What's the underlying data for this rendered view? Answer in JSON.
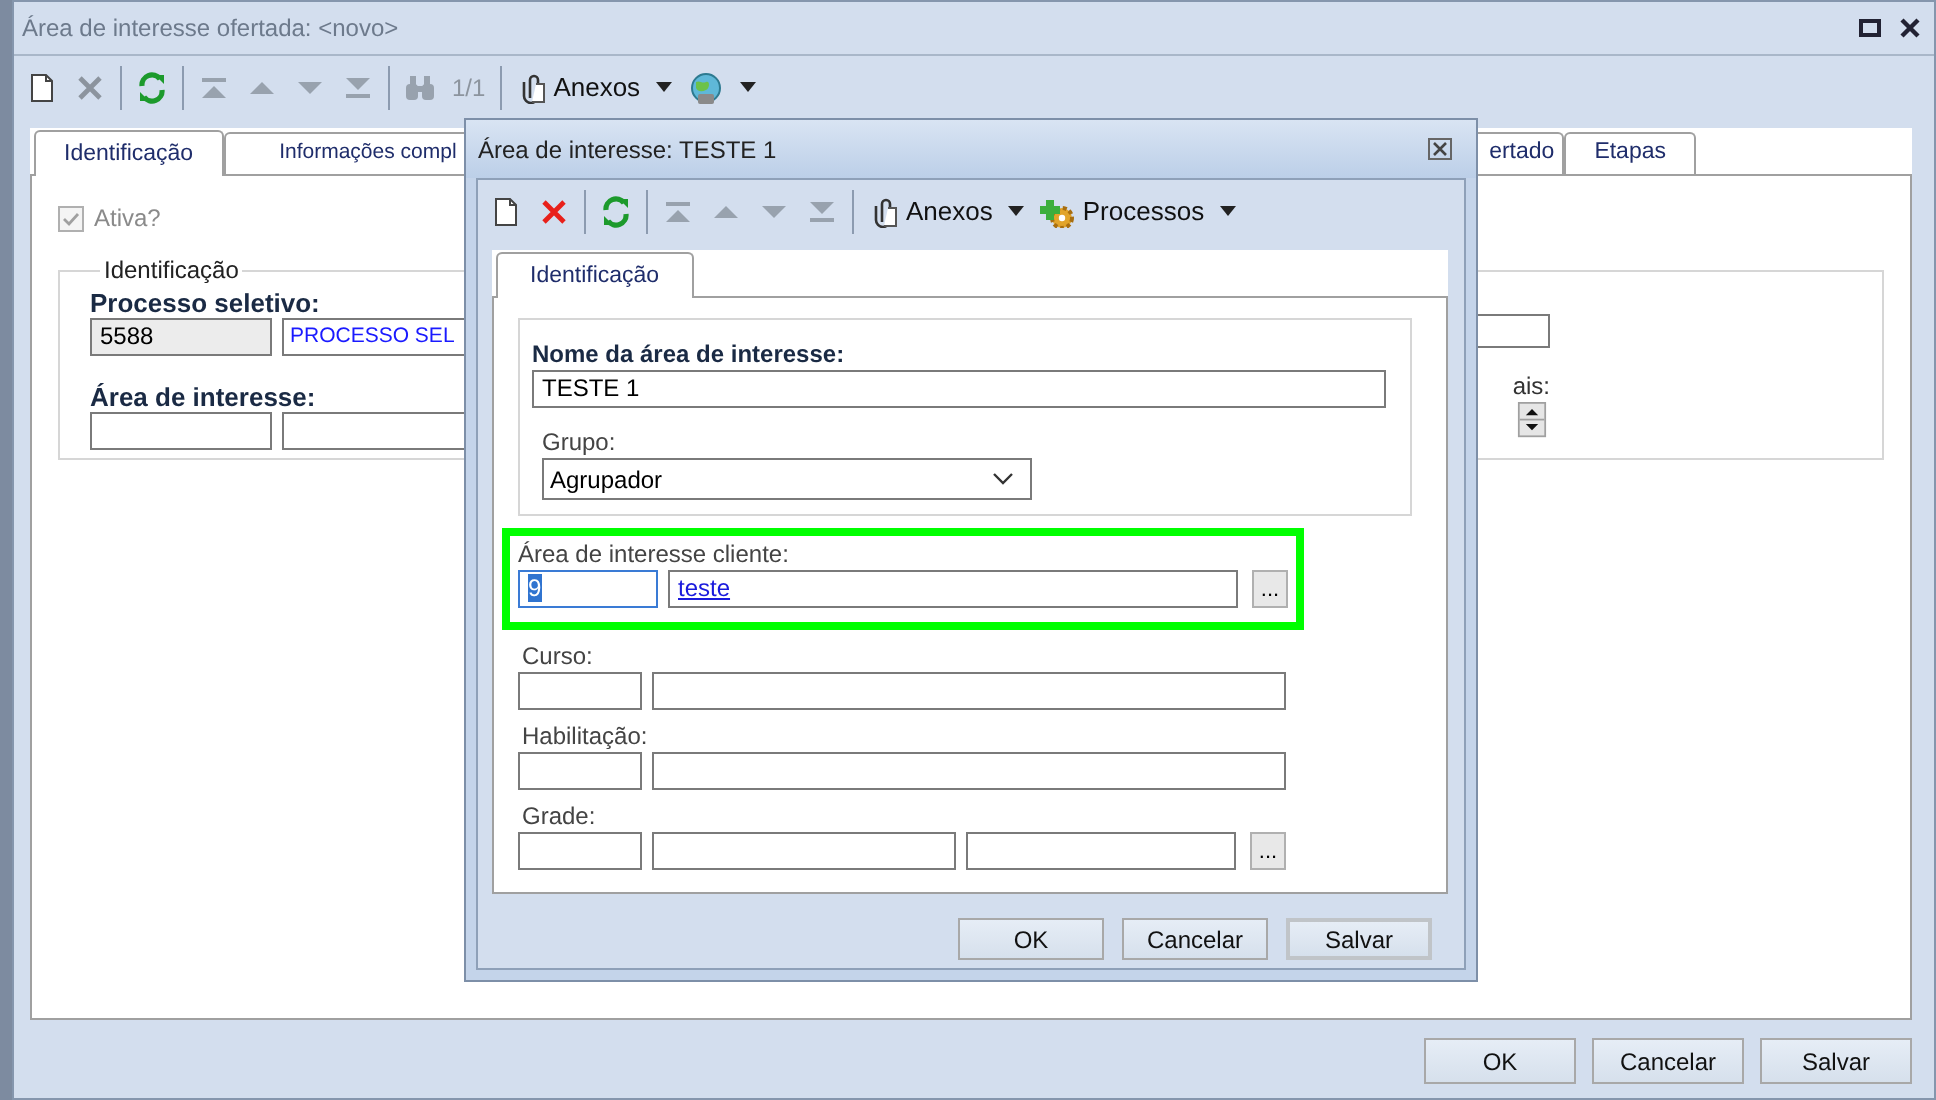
{
  "window": {
    "title": "Área de interesse ofertada: <novo>"
  },
  "toolbar": [
    {
      "kind": "new",
      "disabled": false
    },
    {
      "kind": "delete",
      "disabled": true
    },
    {
      "kind": "separator"
    },
    {
      "kind": "refresh",
      "disabled": false
    },
    {
      "kind": "separator"
    },
    {
      "kind": "first",
      "disabled": true
    },
    {
      "kind": "previous",
      "disabled": true
    },
    {
      "kind": "next",
      "disabled": true
    },
    {
      "kind": "last",
      "disabled": true
    },
    {
      "kind": "separator"
    },
    {
      "kind": "find",
      "disabled": true
    },
    {
      "kind": "counter",
      "label": "1/1",
      "disabled": true
    },
    {
      "kind": "separator"
    },
    {
      "kind": "attachments",
      "label": "Anexos"
    },
    {
      "kind": "globe"
    }
  ],
  "tabs": [
    {
      "label": "Identificação",
      "selected": true
    },
    {
      "label": "Informações compl",
      "selected": false
    },
    {
      "label": "ertado",
      "selected": false
    },
    {
      "label": "Etapas",
      "selected": false
    }
  ],
  "active_checkbox": {
    "label": "Ativa?",
    "checked": true,
    "disabled": true
  },
  "identification": {
    "caption": "Identificação",
    "process_label": "Processo seletivo:",
    "process_code": {
      "value": "5588",
      "readonly": true
    },
    "process_name": "PROCESSO SEL",
    "area_label": "Área de interesse:",
    "partial_label": "ais:"
  },
  "buttons": [
    "OK",
    "Cancelar",
    "Salvar"
  ],
  "dialog": {
    "title": "Área de interesse: TESTE 1",
    "toolbar": [
      {
        "kind": "new",
        "disabled": false
      },
      {
        "kind": "delete",
        "disabled": false
      },
      {
        "kind": "separator"
      },
      {
        "kind": "refresh",
        "disabled": false
      },
      {
        "kind": "separator"
      },
      {
        "kind": "first",
        "disabled": true
      },
      {
        "kind": "previous",
        "disabled": true
      },
      {
        "kind": "next",
        "disabled": true
      },
      {
        "kind": "last",
        "disabled": true
      },
      {
        "kind": "separator"
      },
      {
        "kind": "attachments",
        "label": "Anexos"
      },
      {
        "kind": "processes",
        "label": "Processos"
      }
    ],
    "tabs": [
      {
        "label": "Identificação",
        "selected": true
      }
    ],
    "name_label": "Nome da área de interesse:",
    "name_value": "TESTE 1",
    "group_label": "Grupo:",
    "group_value": "Agrupador",
    "client_label": "Área de interesse cliente:",
    "client_code": {
      "value": "9",
      "selected": true
    },
    "client_name": "teste",
    "client_button": "...",
    "rows": [
      {
        "label": "Curso:",
        "kind": "pair"
      },
      {
        "label": "Habilitação:",
        "kind": "pair"
      },
      {
        "label": "Grade:",
        "kind": "triple",
        "button": "..."
      }
    ],
    "buttons": [
      {
        "label": "OK",
        "focused": false
      },
      {
        "label": "Cancelar",
        "focused": false
      },
      {
        "label": "Salvar",
        "focused": true
      }
    ]
  }
}
